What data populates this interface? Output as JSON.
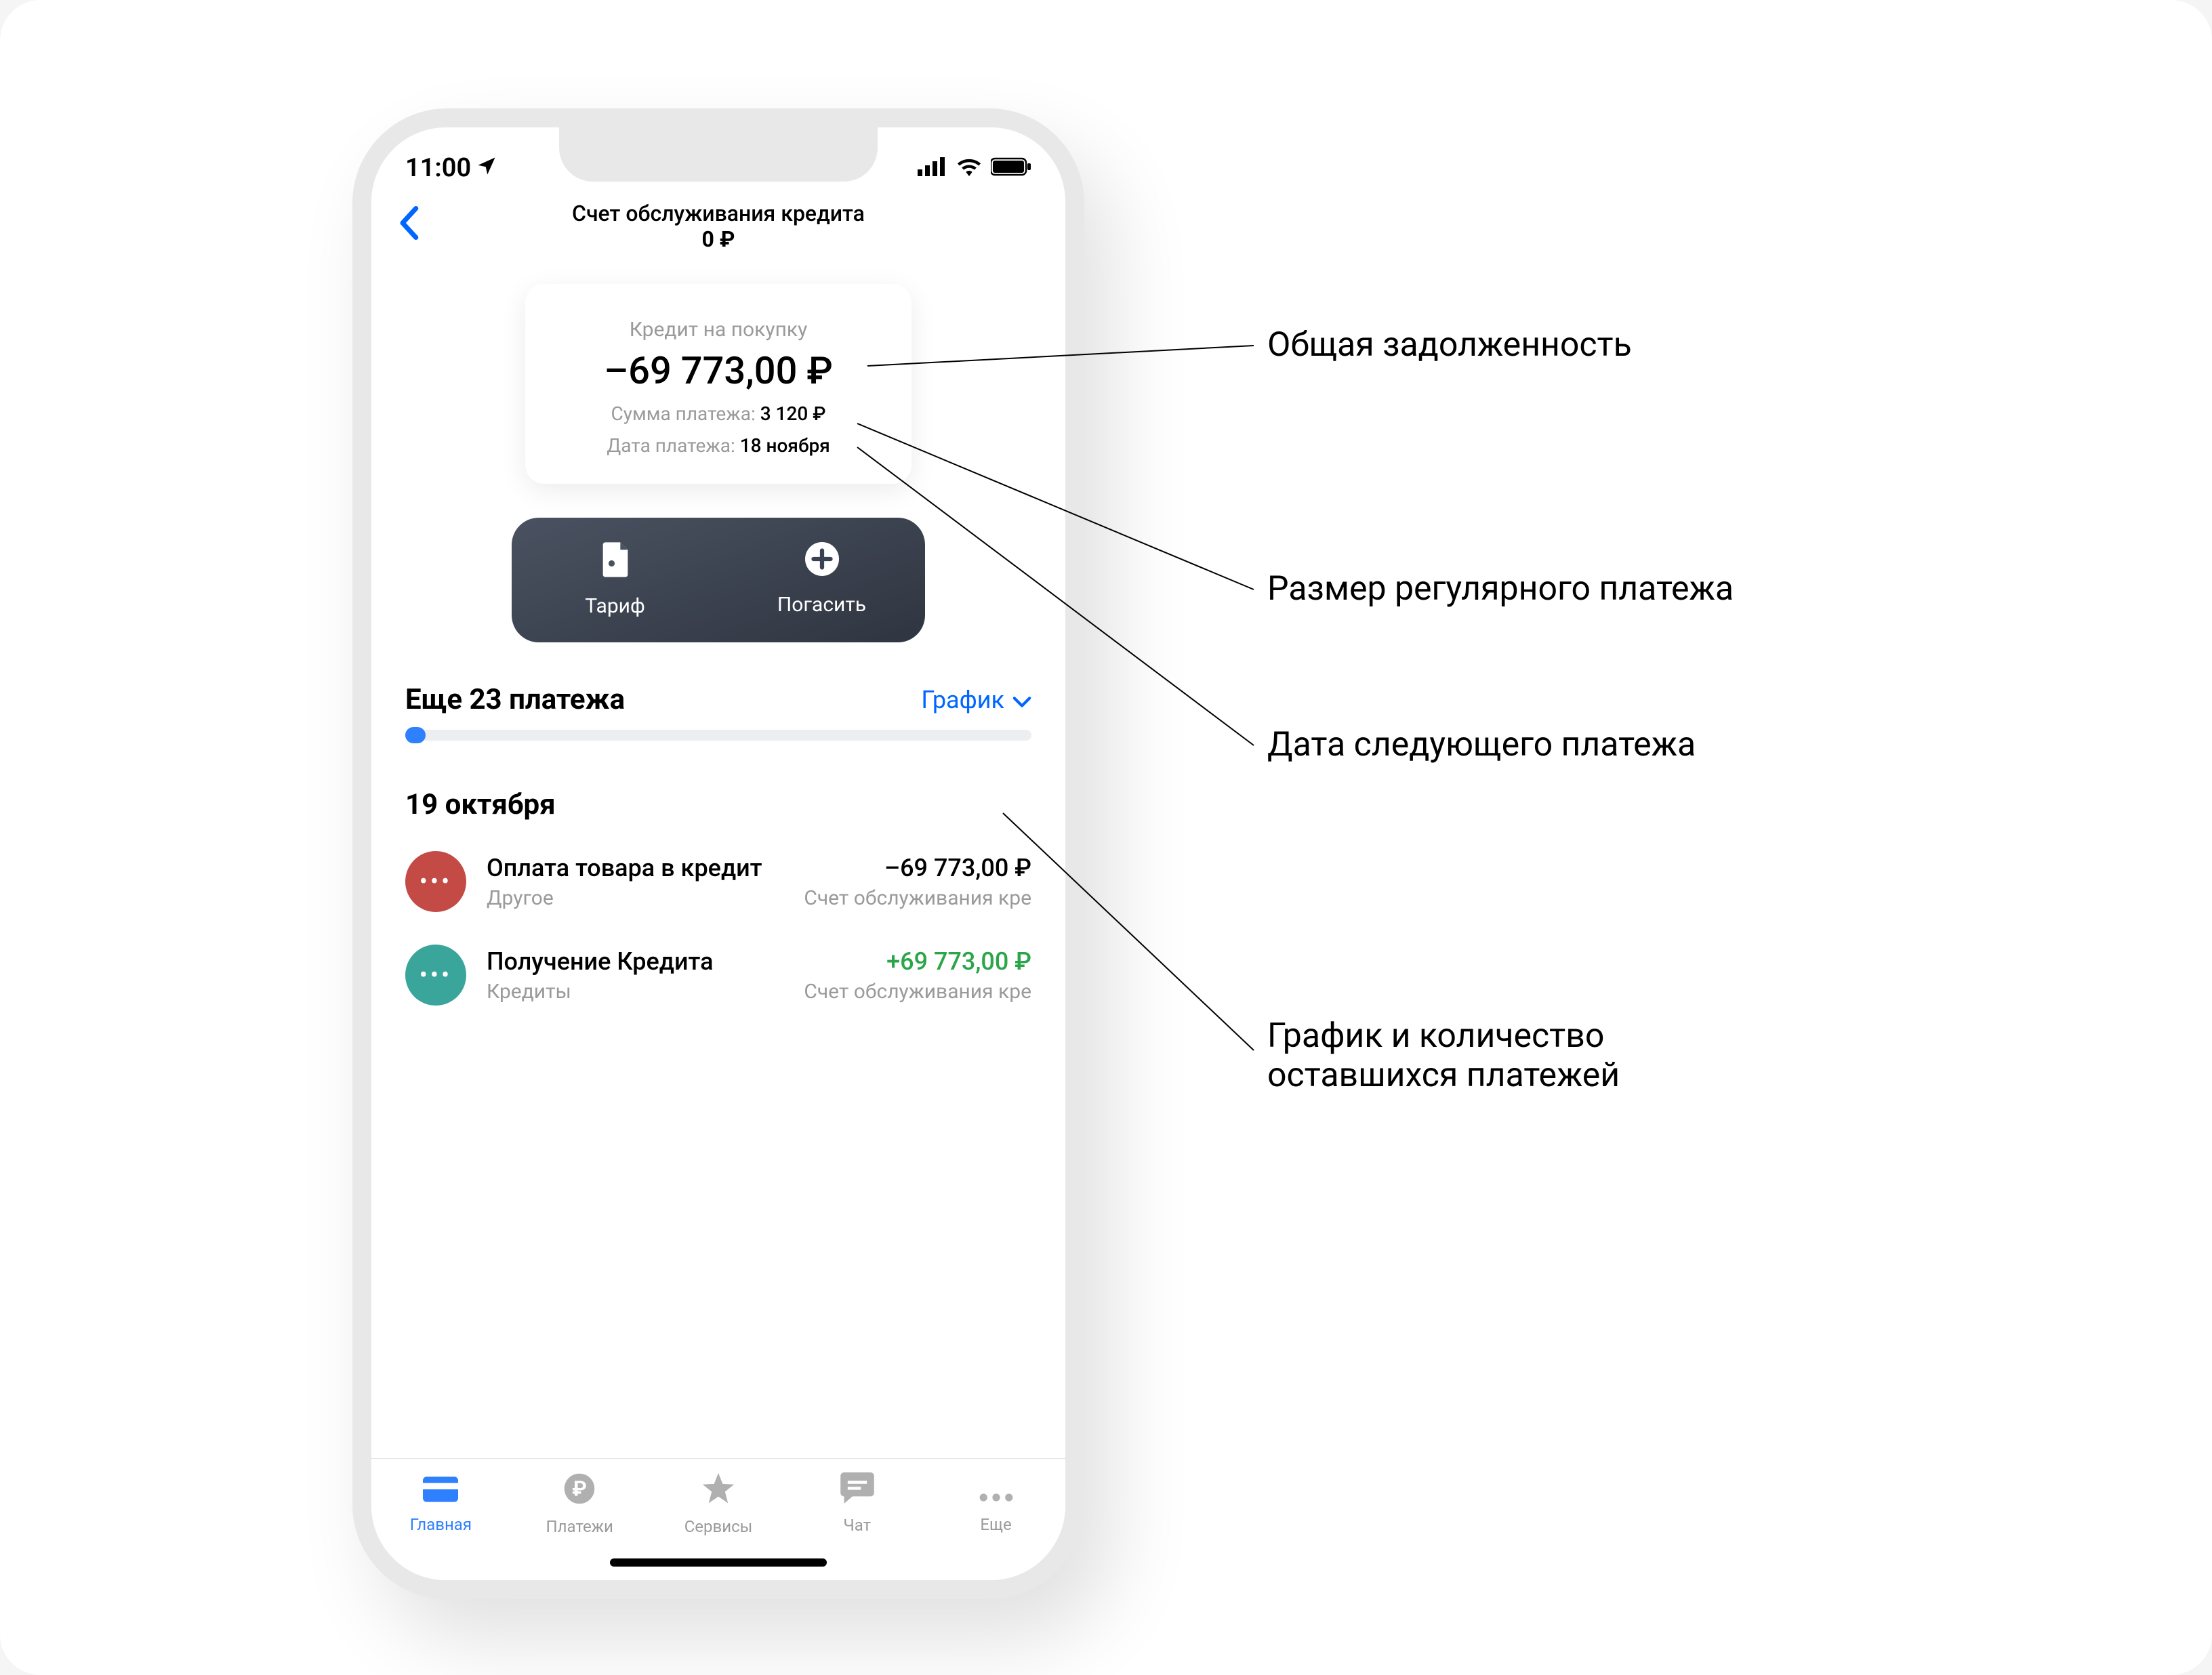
{
  "status": {
    "time": "11:00"
  },
  "header": {
    "title": "Счет обслуживания кредита",
    "balance": "0 ₽"
  },
  "card": {
    "label": "Кредит на покупку",
    "balance": "–69 773,00 ₽",
    "payment_amount_label": "Сумма платежа:",
    "payment_amount_value": "3 120 ₽",
    "payment_date_label": "Дата платежа:",
    "payment_date_value": "18 ноября"
  },
  "actions": {
    "tariff": "Тариф",
    "repay": "Погасить"
  },
  "schedule": {
    "title": "Еще 23 платежа",
    "link": "График"
  },
  "tx_date": "19 октября",
  "tx": [
    {
      "icon_color": "#c44a45",
      "title": "Оплата товара в кредит",
      "amount": "–69 773,00 ₽",
      "positive": false,
      "category": "Другое",
      "account": "Счет обслуживания кре"
    },
    {
      "icon_color": "#3aa59a",
      "title": "Получение Кредита",
      "amount": "+69 773,00 ₽",
      "positive": true,
      "category": "Кредиты",
      "account": "Счет обслуживания кре"
    }
  ],
  "tabs": {
    "home": "Главная",
    "payments": "Платежи",
    "services": "Сервисы",
    "chat": "Чат",
    "more": "Еще"
  },
  "annotations": {
    "a1": "Общая задолженность",
    "a2": "Размер регулярного платежа",
    "a3": "Дата следующего платежа",
    "a4_l1": "График и количество",
    "a4_l2": "оставшихся платежей"
  }
}
